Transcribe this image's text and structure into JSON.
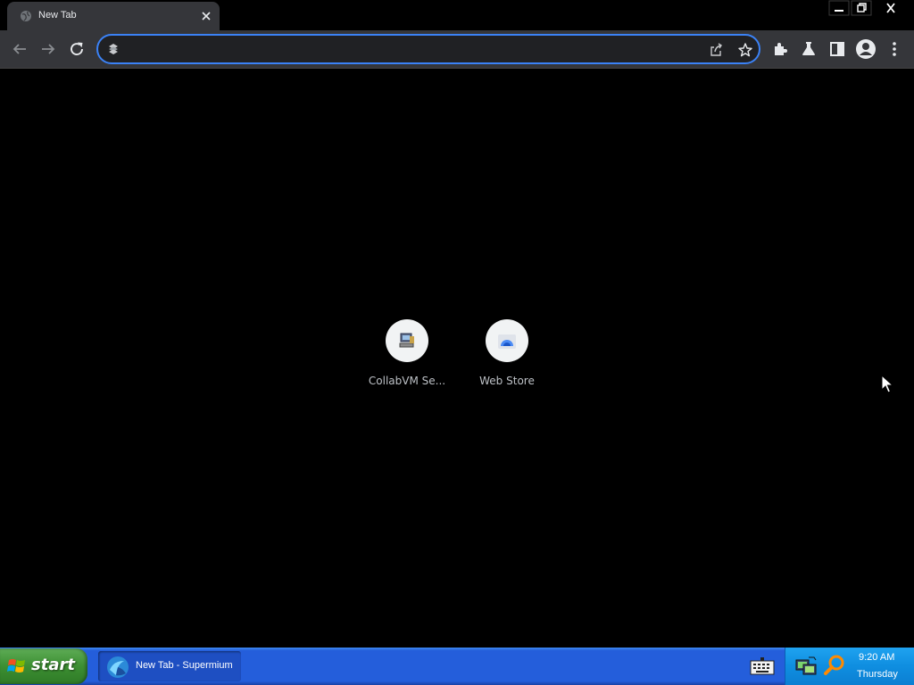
{
  "browser": {
    "tab": {
      "title": "New Tab",
      "favicon": "globe-icon",
      "close_icon": "close-icon"
    },
    "window_controls": [
      "minimize-icon",
      "restore-icon",
      "close-icon"
    ],
    "toolbar": {
      "nav_icons": [
        "back-arrow-icon",
        "forward-arrow-icon",
        "reload-icon"
      ],
      "omnibox": {
        "value": "",
        "placeholder": "",
        "icon": "search-engine-icon"
      },
      "omnibox_icons": [
        "share-icon",
        "star-icon"
      ],
      "extension_icons": [
        "extensions-puzzle-icon",
        "labs-flask-icon",
        "side-panel-icon",
        "profile-avatar-icon",
        "menu-dots-icon"
      ]
    },
    "accent_color": "#3b82f6"
  },
  "new_tab_page": {
    "shortcuts": [
      {
        "label": "CollabVM Se...",
        "icon": "collabvm-computer-icon"
      },
      {
        "label": "Web Store",
        "icon": "web-store-icon"
      }
    ]
  },
  "taskbar": {
    "start_label": "start",
    "start_icon": "windows-flag-icon",
    "task_items": [
      {
        "label": "New Tab - Supermium",
        "icon": "supermium-icon"
      }
    ],
    "tray_icons": [
      "keyboard-icon",
      "network-icon",
      "search-magnifier-icon"
    ],
    "clock": {
      "time": "9:20 AM",
      "day": "Thursday"
    },
    "colors": {
      "bar": "#245edb",
      "start": "#3c8f32",
      "tray": "#0f8ee0"
    }
  }
}
